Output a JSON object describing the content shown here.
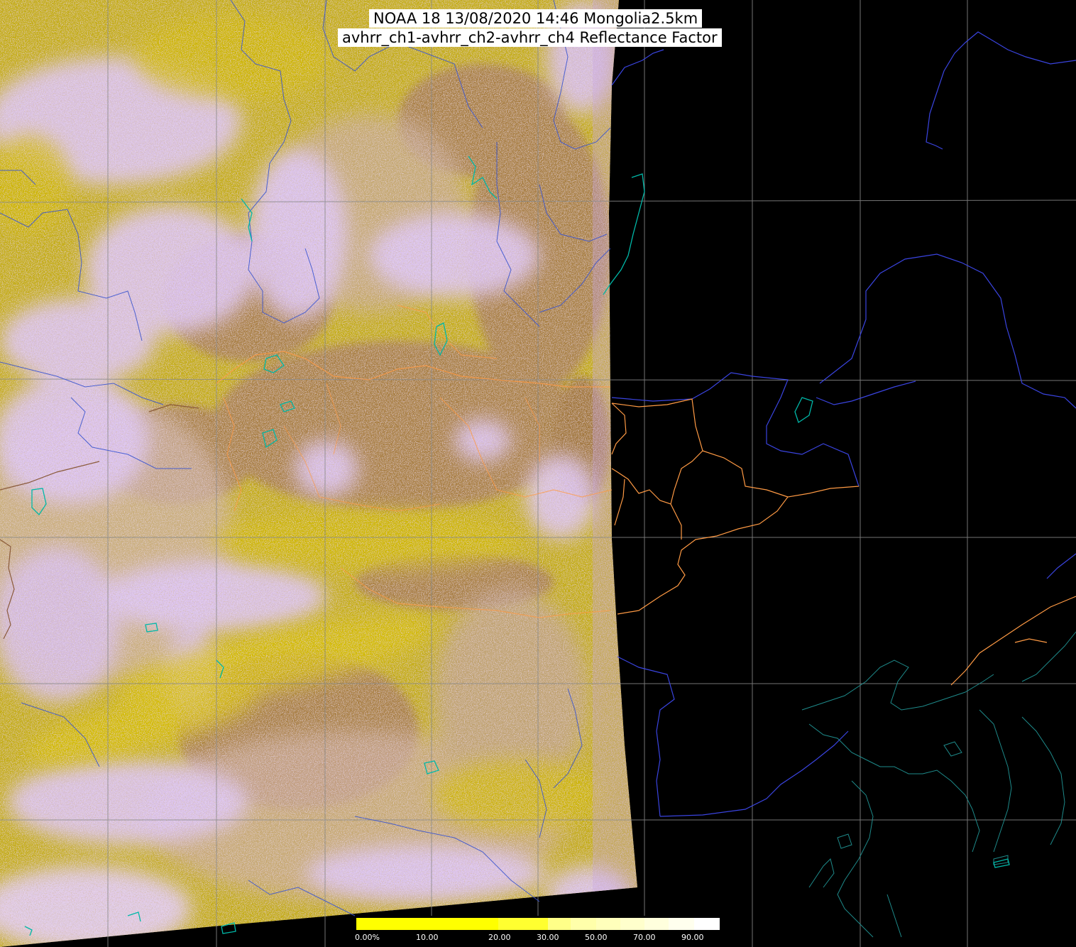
{
  "title": {
    "line1": "NOAA 18 13/08/2020 14:46 Mongolia2.5km",
    "line2": "avhrr_ch1-avhrr_ch2-avhrr_ch4 Reflectance Factor"
  },
  "legend": {
    "labels": [
      "0.00%",
      "10.00",
      "20.00",
      "30.00",
      "50.00",
      "70.00",
      "90.00"
    ],
    "colors": [
      "#ffff00",
      "#ffff00",
      "#ffff33",
      "#ffff88",
      "#ffffbb",
      "#ffffdd",
      "#ffffff"
    ]
  },
  "colors": {
    "background": "#000000",
    "grid": "#888888",
    "coastline": "#3344dd",
    "rivers": "#3355cc",
    "lakes": "#00bbaa",
    "province_borders": "#ff9944",
    "country_borders_west": "#996644",
    "swath_yellow": "#c8b400",
    "swath_cloud": "#d8b8f0",
    "swath_brown": "#a87e56"
  }
}
